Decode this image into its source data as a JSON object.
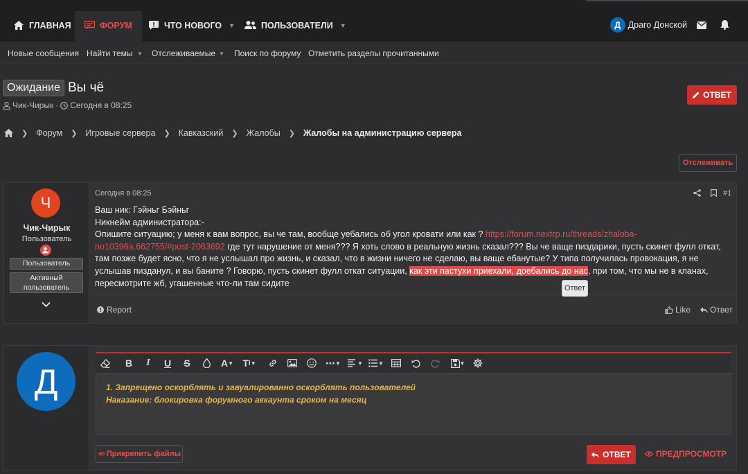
{
  "nav": {
    "home": "ГЛАВНАЯ",
    "forum": "ФОРУМ",
    "whats_new": "ЧТО НОВОГО",
    "users": "ПОЛЬЗОВАТЕЛИ",
    "user_name": "Драго Донской",
    "user_initial": "Д"
  },
  "subnav": [
    "Новые сообщения",
    "Найти темы",
    "Отслеживаемые",
    "Поиск по форуму",
    "Отметить разделы прочитанными"
  ],
  "thread": {
    "prefix": "Ожидание",
    "title": "Вы чё",
    "author": "Чик-Чирык",
    "time": "Сегодня в 08:25",
    "reply_button": "ОТВЕТ"
  },
  "breadcrumb": [
    "Форум",
    "Игровые сервера",
    "Кавказский",
    "Жалобы",
    "Жалобы на администрацию сервера"
  ],
  "watch_button": "Отслеживать",
  "post": {
    "avatar_letter": "Ч",
    "username": "Чик-Чирык",
    "user_title": "Пользователь",
    "badges": [
      "Пользователь",
      "Активный пользователь"
    ],
    "date": "Сегодня в 08:25",
    "number": "#1",
    "line1": "Ваш ник: Гэйньг Бэйньг",
    "line2": "Никнейм администратора:-",
    "line3_a": "Опишите ситуацию; у меня к вам вопрос, вы че там, вообще уебались об угол кровати или как ? ",
    "link": "https://forum.nextrp.ru/threads/zhaloba-no10396a.662755/#post-2063692",
    "line3_b": " где тут нарушение от меня??? Я хоть слово в реальную жизнь сказал??? Вы че ваще пиздарики, пусть скинет фулл откат, там позже будет ясно, что я не услышал про жизнь, и сказал, что в жизни ничего не сделаю, вы ваще ебанутые? У типа получилась провокация, я не услышав пизданул, и вы баните ? Говорю, пусть скинет фулл откат ситуации, ",
    "highlight": "как эти пастухи приехали, доебались до нас",
    "line3_c": ", при том, что мы не в кланах, пересмотрите жб, угашенные что-ли там сидите",
    "tooltip": "Ответ",
    "report": "Report",
    "like": "Like",
    "reply": "Ответ"
  },
  "editor": {
    "avatar_letter": "Д",
    "text_line1": "1. Запрещено оскорблять и завуалированно оскорблять пользователей",
    "text_line2": "Наказание: блокировка форумного аккаунта сроком на месяц",
    "attach": "Прикрепить файлы",
    "submit": "ОТВЕТ",
    "preview": "ПРЕДПРОСМОТР"
  },
  "colors": {
    "accent": "#e94b4b",
    "button": "#c9302c",
    "avatar_post": "#e2441f",
    "avatar_editor": "#0f6cbd"
  }
}
